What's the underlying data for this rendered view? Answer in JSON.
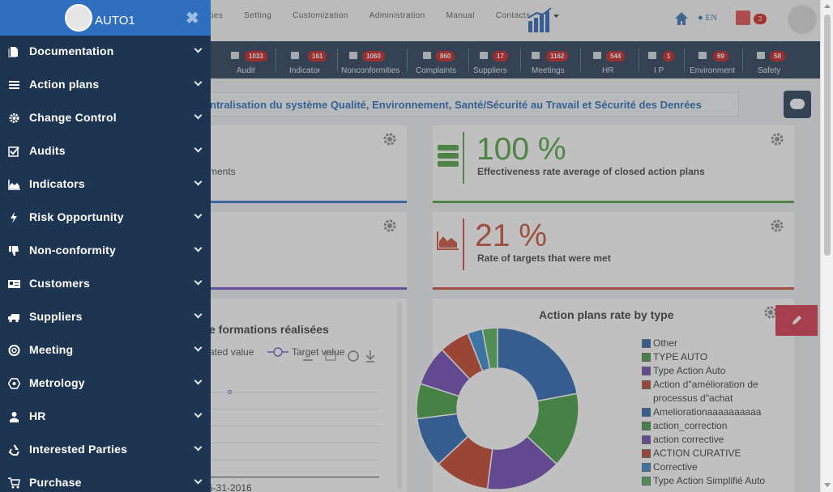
{
  "top_menu": [
    "ties",
    "Setting",
    "Customization",
    "Administration",
    "Manual",
    "Contacts"
  ],
  "language": "EN",
  "notification_count": "2",
  "stats": [
    {
      "count": "1033",
      "label": "Audit",
      "icon": "check-square-icon"
    },
    {
      "count": "161",
      "label": "Indicator",
      "icon": "area-chart-icon"
    },
    {
      "count": "1060",
      "label": "Nonconformities",
      "icon": "thumbs-down-icon"
    },
    {
      "count": "860",
      "label": "Complaints",
      "icon": "comment-icon"
    },
    {
      "count": "17",
      "label": "Suppliers",
      "icon": "truck-icon"
    },
    {
      "count": "1162",
      "label": "Meetings",
      "icon": "life-ring-icon"
    },
    {
      "count": "544",
      "label": "HR",
      "icon": "user-icon"
    },
    {
      "count": "1",
      "label": "I P",
      "icon": "retweet-icon"
    },
    {
      "count": "69",
      "label": "Environment",
      "icon": "bell-icon"
    },
    {
      "count": "58",
      "label": "Safety",
      "icon": "camera-icon"
    }
  ],
  "banner_text": "ntralisation du système Qualité, Environnement, Santé/Sécurité au Travail et Sécurité des Denrées",
  "kpi_cards": [
    {
      "value": "",
      "label": "ments"
    },
    {
      "value": "100 %",
      "label": "Effectiveness rate average of closed action plans",
      "color": "#4a9e3a"
    },
    {
      "value": "",
      "label": ""
    },
    {
      "value": "21 %",
      "label": "Rate of targets that were met",
      "color": "#c84a34"
    }
  ],
  "line_chart": {
    "title": "e formations réalisées",
    "legend_left": "ated value",
    "legend_right": "Target value",
    "x_tick": "5-31-2016"
  },
  "chart_data": {
    "type": "pie",
    "title": "Action plans rate by type",
    "categories": [
      "Other",
      "TYPE AUTO",
      "Type Action Auto",
      "Action d\"amélioration de processus d\"achat",
      "Ameliorationaaaaaaaaaa",
      "action_correction",
      "action corrective",
      "ACTION CURATIVE",
      "Corrective",
      "Type Action Simplifié Auto"
    ],
    "values": [
      22,
      15,
      15,
      11,
      10,
      7,
      8,
      6,
      3,
      3
    ],
    "colors": [
      "#1f5fb0",
      "#3b9b3b",
      "#6a3fb0",
      "#c23b22",
      "#1f5fb0",
      "#3b9b3b",
      "#6a3fb0",
      "#c23b22",
      "#2a86d0",
      "#4caf50"
    ]
  },
  "sidebar": {
    "user": "AUTO1",
    "close": "✖",
    "items": [
      {
        "label": "Documentation",
        "icon": "file-icon"
      },
      {
        "label": "Action plans",
        "icon": "list-icon"
      },
      {
        "label": "Change Control",
        "icon": "gear-icon"
      },
      {
        "label": "Audits",
        "icon": "check-square-icon"
      },
      {
        "label": "Indicators",
        "icon": "area-chart-icon"
      },
      {
        "label": "Risk Opportunity",
        "icon": "bolt-icon"
      },
      {
        "label": "Non-conformity",
        "icon": "thumbs-down-icon"
      },
      {
        "label": "Customers",
        "icon": "id-card-icon"
      },
      {
        "label": "Suppliers",
        "icon": "truck-icon"
      },
      {
        "label": "Meeting",
        "icon": "life-ring-icon"
      },
      {
        "label": "Metrology",
        "icon": "hexagon-icon"
      },
      {
        "label": "HR",
        "icon": "user-icon"
      },
      {
        "label": "Interested Parties",
        "icon": "recycle-icon"
      },
      {
        "label": "Purchase",
        "icon": "cart-icon"
      }
    ]
  }
}
